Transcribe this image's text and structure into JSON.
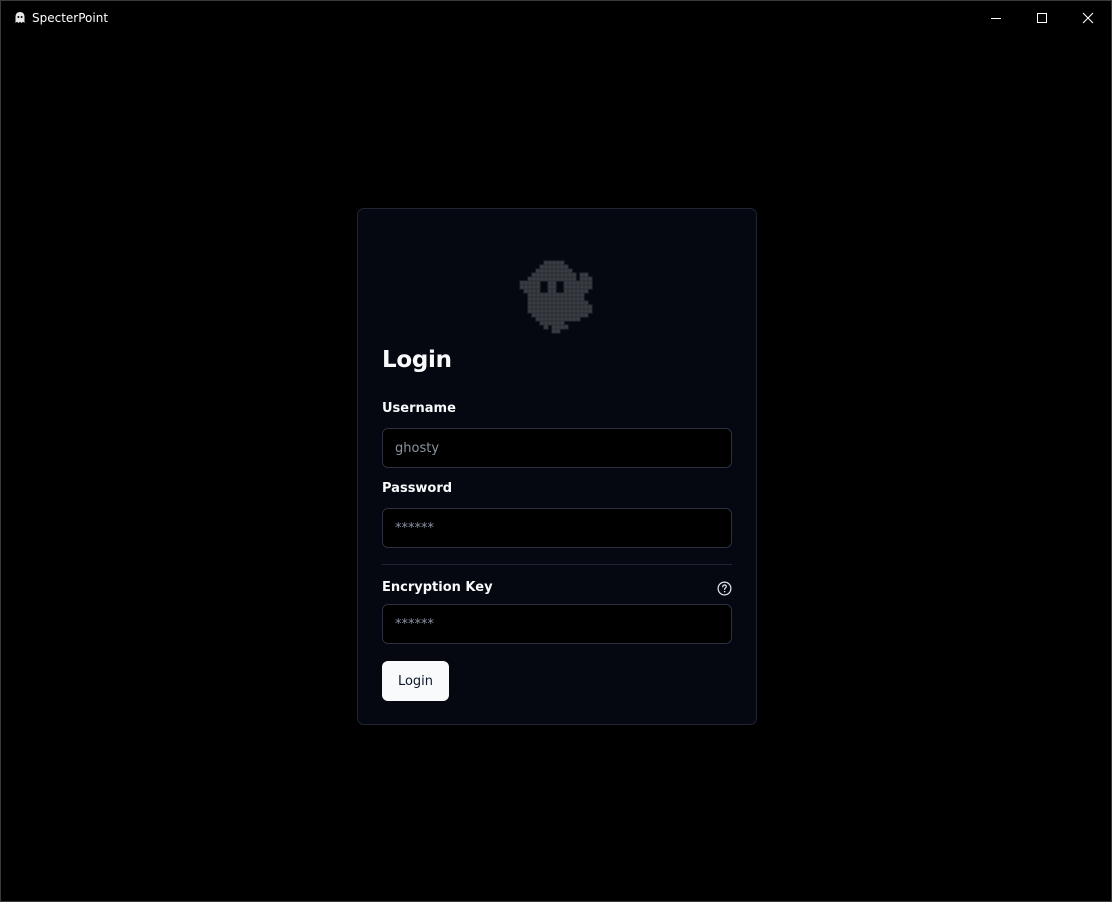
{
  "window": {
    "title": "SpecterPoint",
    "app_icon": "ghost-icon",
    "controls": [
      "minimize-icon",
      "maximize-icon",
      "close-icon"
    ]
  },
  "login": {
    "logo_icon": "pixel-ghost-icon",
    "heading": "Login",
    "username": {
      "label": "Username",
      "placeholder": "ghosty"
    },
    "password": {
      "label": "Password",
      "placeholder": "******"
    },
    "encryption_key": {
      "label": "Encryption Key",
      "placeholder": "******",
      "help_icon": "question-circle-icon"
    },
    "submit_label": "Login"
  },
  "colors": {
    "background": "#000000",
    "card_background": "#050811",
    "card_border": "#1f2533",
    "button_background": "#f8fafc",
    "button_text": "#0f172a",
    "ghost": "#3b3d44"
  }
}
